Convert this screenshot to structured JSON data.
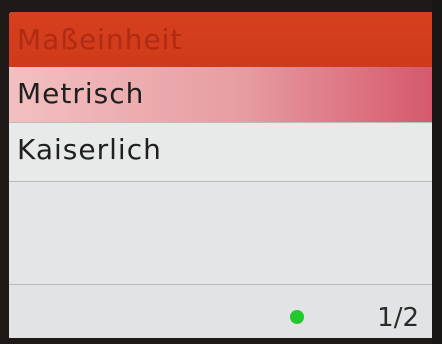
{
  "header": {
    "title": "Maßeinheit"
  },
  "menu": {
    "items": [
      {
        "label": "Metrisch",
        "selected": true
      },
      {
        "label": "Kaiserlich",
        "selected": false
      }
    ]
  },
  "footer": {
    "status_color": "#22c92e",
    "page_indicator": "1/2"
  },
  "colors": {
    "header_bg": "#d6401f",
    "selected_bg": "#e79ca3",
    "screen_bg": "#e4e6e7"
  }
}
